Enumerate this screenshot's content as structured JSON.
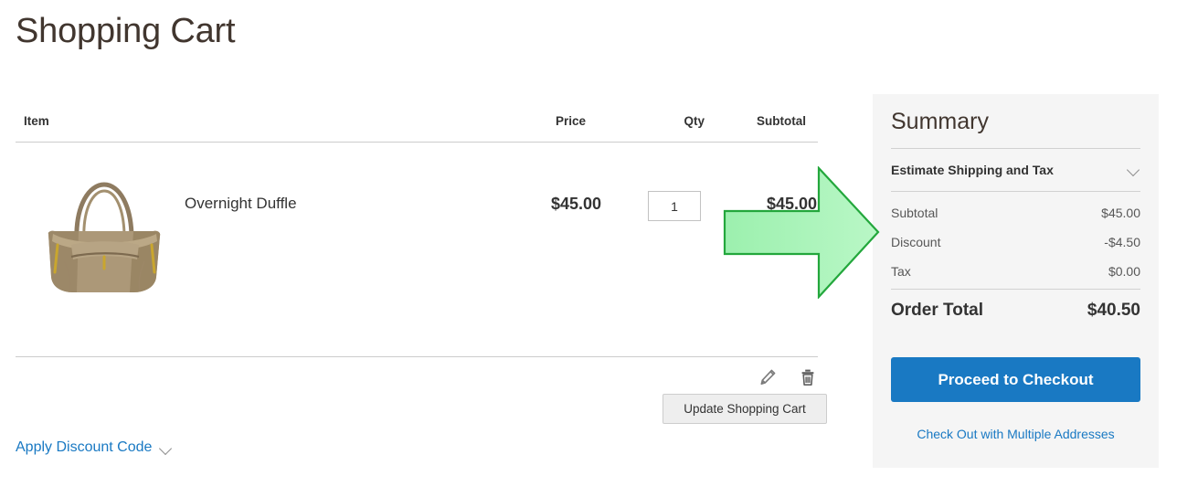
{
  "page": {
    "title": "Shopping Cart"
  },
  "cart_table": {
    "headers": {
      "item": "Item",
      "price": "Price",
      "qty": "Qty",
      "subtotal": "Subtotal"
    },
    "rows": [
      {
        "name": "Overnight Duffle",
        "price": "$45.00",
        "qty": "1",
        "qty_placeholder": "1",
        "subtotal": "$45.00",
        "image_alt": "Overnight Duffle tan canvas bag",
        "edit_icon": "pencil-icon",
        "delete_icon": "trash-icon"
      }
    ]
  },
  "actions": {
    "update_cart_label": "Update Shopping Cart",
    "apply_discount_label": "Apply Discount Code",
    "apply_discount_icon": "chevron-down-icon"
  },
  "summary": {
    "title": "Summary",
    "estimate": {
      "label": "Estimate Shipping and Tax",
      "icon": "chevron-down-icon"
    },
    "totals": [
      {
        "label": "Subtotal",
        "value": "$45.00"
      },
      {
        "label": "Discount",
        "value": "-$4.50"
      },
      {
        "label": "Tax",
        "value": "$0.00"
      }
    ],
    "order_total": {
      "label": "Order Total",
      "value": "$40.50"
    },
    "checkout_label": "Proceed to Checkout",
    "multi_address_label": "Check Out with Multiple Addresses"
  },
  "annotation": {
    "type": "arrow-right",
    "fill_color": "#a9f4b9",
    "stroke_color": "#22a63a"
  },
  "colors": {
    "accent_blue": "#1979c3",
    "panel_background": "#f5f5f5",
    "text_primary": "#333333",
    "heading": "#41362f"
  }
}
